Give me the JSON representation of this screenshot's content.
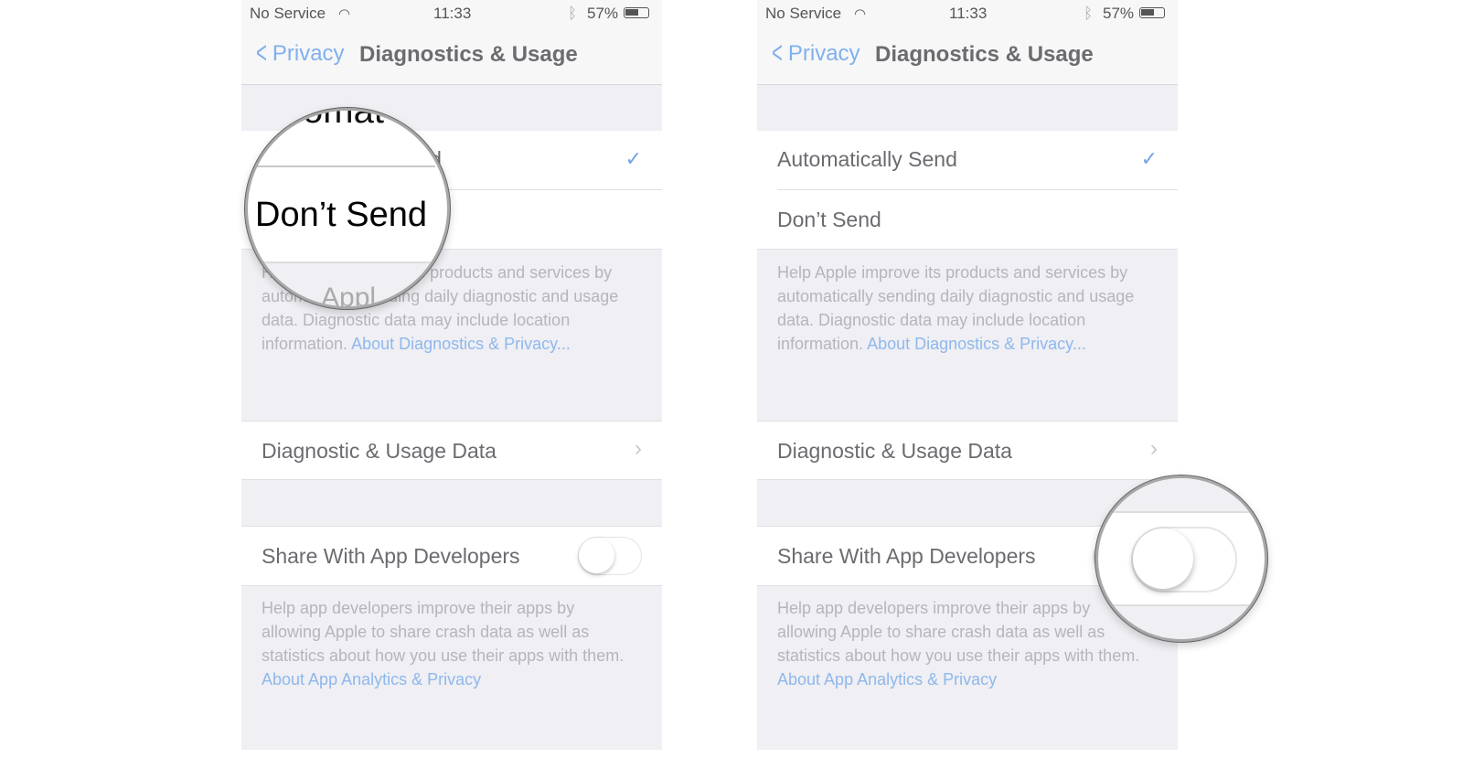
{
  "phones": [
    {
      "status": {
        "carrier": "No Service",
        "time": "11:33",
        "battery": "57%"
      },
      "nav": {
        "back": "Privacy",
        "title": "Diagnostics & Usage"
      },
      "options": [
        {
          "label": "Automatically Send",
          "selected": true
        },
        {
          "label": "Don’t Send",
          "selected": false
        }
      ],
      "footer1": {
        "text": "Help Apple improve its products and services by automatically sending daily diagnostic and usage data. Diagnostic data may include location information. ",
        "link": "About Diagnostics & Privacy..."
      },
      "data_row": "Diagnostic & Usage Data",
      "share": {
        "label": "Share With App Developers",
        "on": false
      },
      "footer2": {
        "text": "Help app developers improve their apps by allowing Apple to share crash data as well as statistics about how you use their apps with them. ",
        "link": "About App Analytics & Privacy"
      },
      "magnifier": {
        "top_text": "omat",
        "main_text": "Don’t Send",
        "bottom_text": "Appl"
      }
    },
    {
      "status": {
        "carrier": "No Service",
        "time": "11:33",
        "battery": "57%"
      },
      "nav": {
        "back": "Privacy",
        "title": "Diagnostics & Usage"
      },
      "options": [
        {
          "label": "Automatically Send",
          "selected": true
        },
        {
          "label": "Don’t Send",
          "selected": false
        }
      ],
      "footer1": {
        "text": "Help Apple improve its products and services by automatically sending daily diagnostic and usage data. Diagnostic data may include location information. ",
        "link": "About Diagnostics & Privacy..."
      },
      "data_row": "Diagnostic & Usage Data",
      "share": {
        "label": "Share With App Developers",
        "on": false
      },
      "footer2": {
        "text": "Help app developers improve their apps by allowing Apple to share crash data as well as statistics about how you use their apps with them. ",
        "link": "About App Analytics & Privacy"
      }
    }
  ]
}
